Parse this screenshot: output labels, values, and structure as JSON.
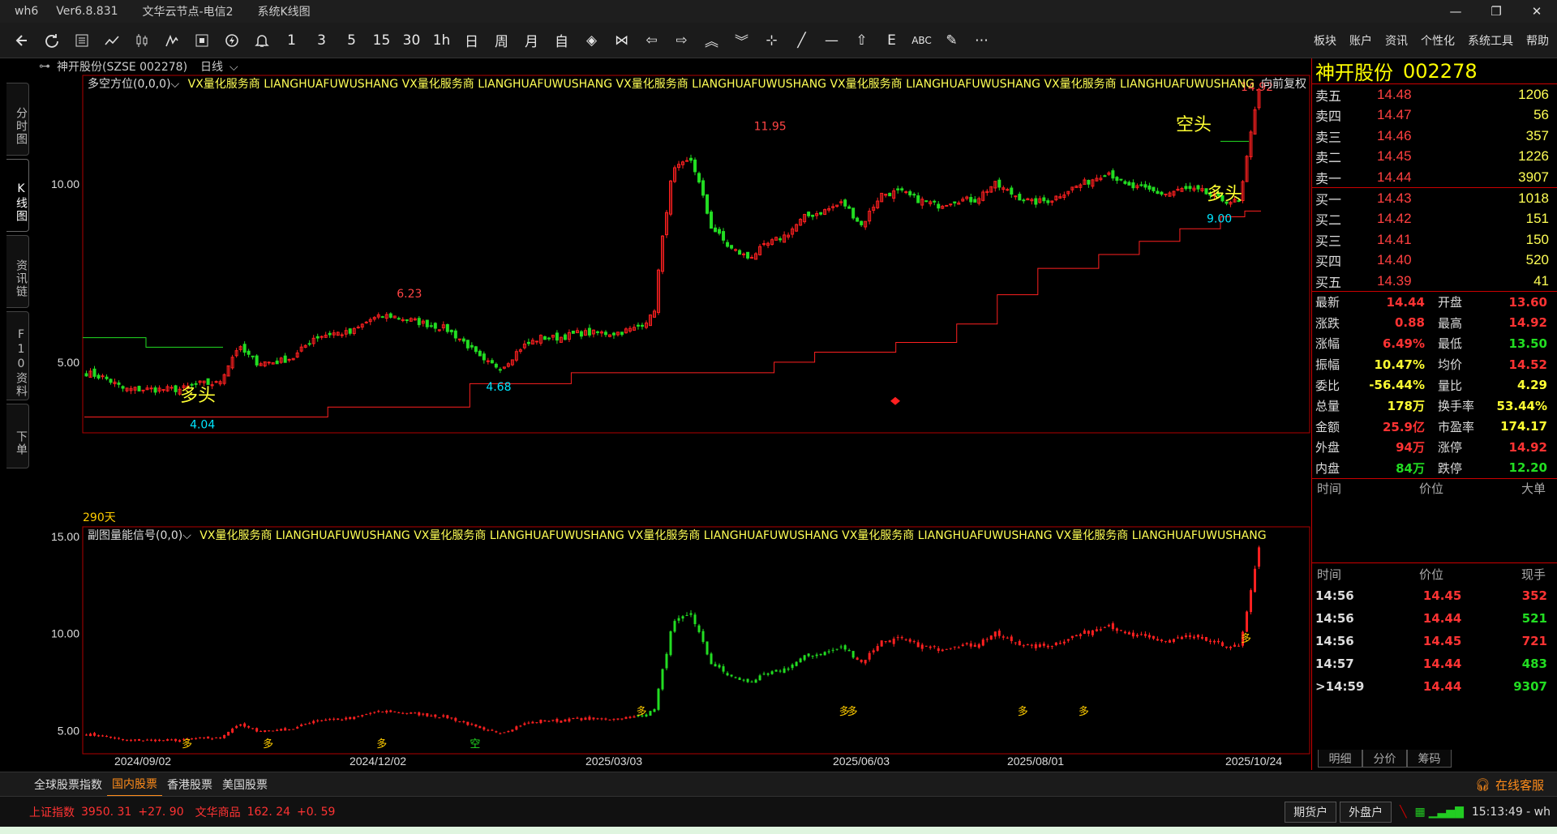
{
  "titlebar": {
    "app": "wh6",
    "version": "Ver6.8.831",
    "server": "文华云节点-电信2",
    "view": "系统K线图"
  },
  "window_controls": [
    "—",
    "❐",
    "✕"
  ],
  "toolbar": {
    "items": [
      "back-icon",
      "refresh-icon",
      "list-icon",
      "line-chart-icon",
      "candle-icon",
      "signal-icon",
      "box-icon",
      "flash-icon",
      "bell-icon"
    ],
    "periods": [
      "1",
      "3",
      "5",
      "15",
      "30",
      "1h",
      "日",
      "周",
      "月",
      "自"
    ],
    "menu": [
      "板块",
      "账户",
      "资讯",
      "个性化",
      "系统工具",
      "帮助"
    ]
  },
  "lefttabs": [
    "分时图",
    "K线图",
    "资讯链",
    "F10资料",
    "下单"
  ],
  "chart": {
    "instrument": "神开股份(SZSE 002278)",
    "period": "日线",
    "main_indicator": "多空方位(0,0,0)",
    "ad_text": "VX量化服务商  LIANGHUAFUWUSHANG  VX量化服务商  LIANGHUAFUWUSHANG  VX量化服务商  LIANGHUAFUWUSHANG  VX量化服务商  LIANGHUAFUWUSHANG  VX量化服务商  LIANGHUAFUWUSHANG",
    "right_label": "向前复权",
    "sub_indicator": "副图量能信号(0,0)",
    "days_label": "290天"
  },
  "chart_data": [
    {
      "type": "line",
      "title": "",
      "y_ticks": [
        "10.00",
        "5.00"
      ],
      "ylim": [
        3.8,
        15.2
      ],
      "x_ticks": [
        "2024/09/02",
        "2024/12/02",
        "2025/03/03",
        "2025/06/03",
        "2025/08/01",
        "2025/10/24"
      ],
      "annotations": [
        {
          "text": "11.95"
        },
        {
          "text": "6.23"
        },
        {
          "text": "4.68"
        },
        {
          "text": "4.04"
        },
        {
          "text": "14.92"
        },
        {
          "text": "9.00"
        },
        {
          "text": "多头"
        },
        {
          "text": "多头"
        },
        {
          "text": "空头"
        }
      ],
      "series": [
        {
          "values": [
            4.8,
            4.7,
            4.5,
            4.5,
            4.5,
            4.5,
            4.6,
            4.6,
            5.3,
            5.0,
            5.0,
            5.1,
            5.5,
            5.6,
            5.6,
            5.9,
            6.0,
            5.9,
            5.8,
            5.7,
            5.4,
            5.0,
            4.9,
            5.3,
            5.5,
            5.5,
            5.6,
            5.6,
            5.6,
            5.7,
            6.0,
            10.5,
            11.0,
            8.5,
            7.8,
            7.5,
            7.9,
            8.2,
            8.8,
            9.0,
            9.3,
            8.5,
            9.6,
            9.7,
            9.4,
            9.2,
            9.4,
            9.4,
            10.0,
            9.6,
            9.3,
            9.4,
            9.8,
            10.1,
            10.5,
            9.9,
            9.8,
            9.6,
            9.8,
            9.7,
            9.4,
            9.3,
            14.44
          ]
        }
      ]
    },
    {
      "type": "line",
      "title": "",
      "y_ticks": [
        "15.00",
        "10.00",
        "5.00"
      ],
      "ylim": [
        3.8,
        15.5
      ],
      "markers": [
        "多",
        "多",
        "多",
        "空",
        "多",
        "多",
        "多",
        "多",
        "多",
        "多"
      ],
      "series": [
        {
          "values": [
            4.8,
            4.7,
            4.5,
            4.5,
            4.5,
            4.5,
            4.6,
            4.6,
            5.3,
            5.0,
            5.0,
            5.1,
            5.5,
            5.6,
            5.6,
            5.9,
            6.0,
            5.9,
            5.8,
            5.7,
            5.4,
            5.0,
            4.9,
            5.3,
            5.5,
            5.5,
            5.6,
            5.6,
            5.6,
            5.7,
            6.0,
            10.5,
            11.0,
            8.5,
            7.8,
            7.5,
            7.9,
            8.2,
            8.8,
            9.0,
            9.3,
            8.5,
            9.6,
            9.7,
            9.4,
            9.2,
            9.4,
            9.4,
            10.0,
            9.6,
            9.3,
            9.4,
            9.8,
            10.1,
            10.5,
            9.9,
            9.8,
            9.6,
            9.8,
            9.7,
            9.4,
            9.3,
            14.44
          ]
        }
      ]
    }
  ],
  "panel": {
    "name": "神开股份",
    "code": "002278",
    "asks": [
      {
        "n": "卖五",
        "p": "14.48",
        "v": "1206"
      },
      {
        "n": "卖四",
        "p": "14.47",
        "v": "56"
      },
      {
        "n": "卖三",
        "p": "14.46",
        "v": "357"
      },
      {
        "n": "卖二",
        "p": "14.45",
        "v": "1226"
      },
      {
        "n": "卖一",
        "p": "14.44",
        "v": "3907"
      }
    ],
    "bids": [
      {
        "n": "买一",
        "p": "14.43",
        "v": "1018"
      },
      {
        "n": "买二",
        "p": "14.42",
        "v": "151"
      },
      {
        "n": "买三",
        "p": "14.41",
        "v": "150"
      },
      {
        "n": "买四",
        "p": "14.40",
        "v": "520"
      },
      {
        "n": "买五",
        "p": "14.39",
        "v": "41"
      }
    ],
    "quote": [
      [
        "最新",
        "14.44",
        "red",
        "开盘",
        "13.60",
        "red"
      ],
      [
        "涨跌",
        "0.88",
        "red",
        "最高",
        "14.92",
        "red"
      ],
      [
        "涨幅",
        "6.49%",
        "red",
        "最低",
        "13.50",
        "green"
      ],
      [
        "振幅",
        "10.47%",
        "yellow",
        "均价",
        "14.52",
        "red"
      ],
      [
        "委比",
        "-56.44%",
        "yellow",
        "量比",
        "4.29",
        "yellow"
      ],
      [
        "总量",
        "178万",
        "yellow",
        "换手率",
        "53.44%",
        "yellow"
      ],
      [
        "金额",
        "25.9亿",
        "red",
        "市盈率",
        "174.17",
        "yellow"
      ],
      [
        "外盘",
        "94万",
        "red",
        "涨停",
        "14.92",
        "red"
      ],
      [
        "内盘",
        "84万",
        "green",
        "跌停",
        "12.20",
        "green"
      ]
    ],
    "big_head": [
      "时间",
      "价位",
      "大单"
    ],
    "tick_head": [
      "时间",
      "价位",
      "现手"
    ],
    "ticks": [
      {
        "t": "14:56",
        "p": "14.45",
        "v": "352",
        "c": "red"
      },
      {
        "t": "14:56",
        "p": "14.44",
        "v": "521",
        "c": "green"
      },
      {
        "t": "14:56",
        "p": "14.45",
        "v": "721",
        "c": "red"
      },
      {
        "t": "14:57",
        "p": "14.44",
        "v": "483",
        "c": "green"
      },
      {
        "t": ">14:59",
        "p": "14.44",
        "v": "9307",
        "c": "green"
      }
    ],
    "bottom_tabs": [
      "明细",
      "分价",
      "筹码"
    ]
  },
  "bottombar": {
    "tabs": [
      "全球股票指数",
      "国内股票",
      "香港股票",
      "美国股票"
    ],
    "active": 1,
    "service": "在线客服"
  },
  "statusbar": {
    "idx1_name": "上证指数",
    "idx1_val": "3950. 31",
    "idx1_chg": "+27. 90",
    "idx2_name": "文华商品",
    "idx2_val": "162. 24",
    "idx2_chg": "+0. 59",
    "btn1": "期货户",
    "btn2": "外盘户",
    "time": "15:13:49 - wh"
  }
}
